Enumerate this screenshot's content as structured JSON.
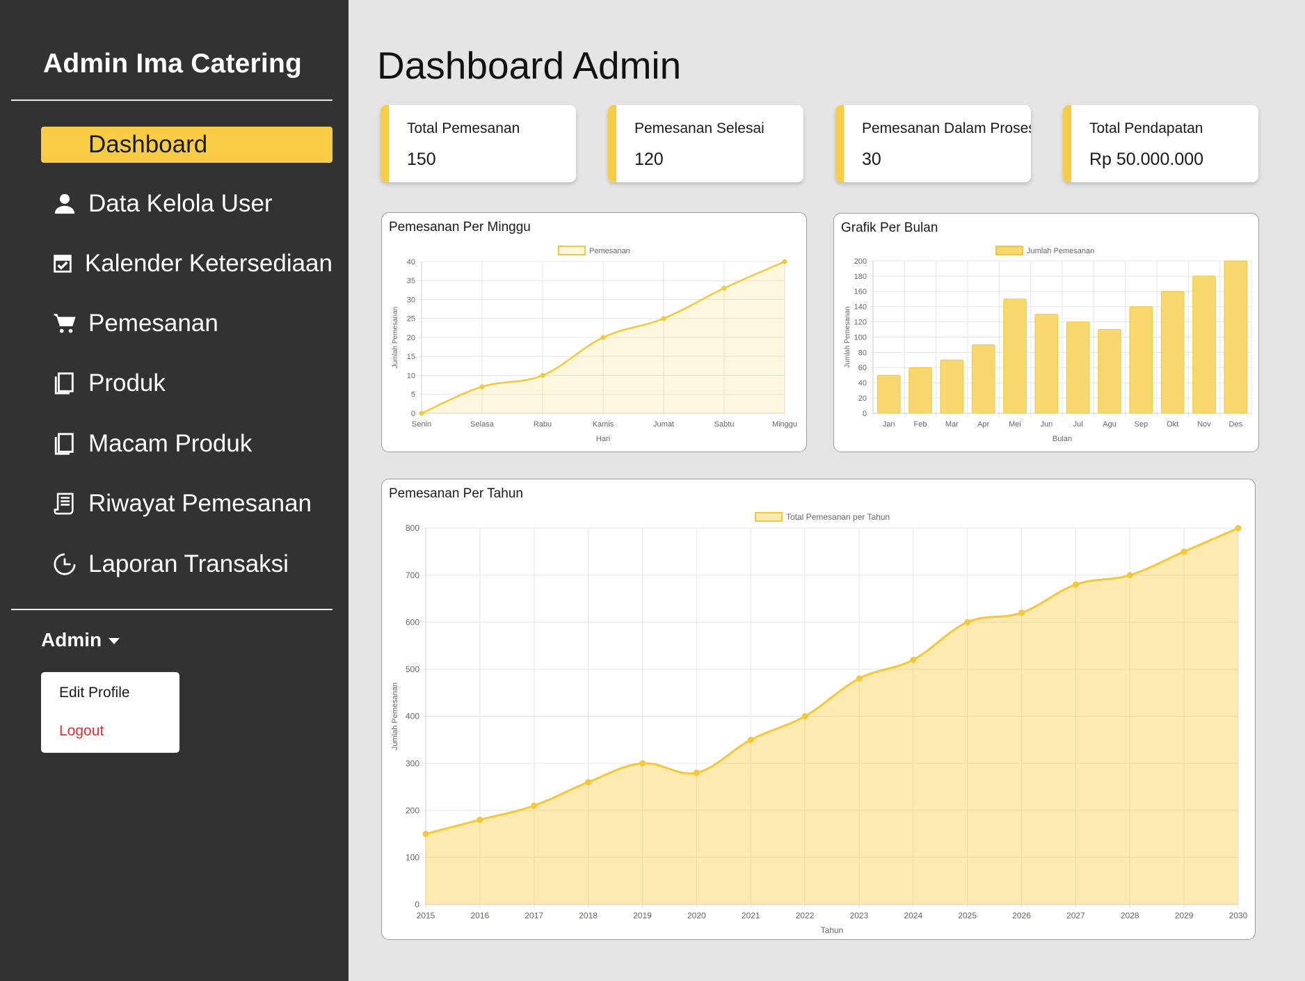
{
  "sidebar": {
    "brand": "Admin Ima Catering",
    "items": [
      {
        "label": "Dashboard",
        "icon": "dashboard-icon",
        "active": true
      },
      {
        "label": "Data Kelola User",
        "icon": "user-icon"
      },
      {
        "label": "Kalender Ketersediaan",
        "icon": "calendar-check-icon"
      },
      {
        "label": "Pemesanan",
        "icon": "cart-icon"
      },
      {
        "label": "Produk",
        "icon": "copy-icon"
      },
      {
        "label": "Macam Produk",
        "icon": "copy-icon"
      },
      {
        "label": "Riwayat Pemesanan",
        "icon": "receipt-icon"
      },
      {
        "label": "Laporan Transaksi",
        "icon": "clock-report-icon"
      }
    ],
    "admin_label": "Admin",
    "dropdown": {
      "edit_profile": "Edit Profile",
      "logout": "Logout"
    }
  },
  "main": {
    "title": "Dashboard Admin",
    "stats": [
      {
        "label": "Total Pemesanan",
        "value": "150"
      },
      {
        "label": "Pemesanan Selesai",
        "value": "120"
      },
      {
        "label": "Pemesanan Dalam Proses",
        "value": "30"
      },
      {
        "label": "Total Pendapatan",
        "value": "Rp 50.000.000"
      }
    ]
  },
  "colors": {
    "accent": "#f8cd45",
    "sidebar": "#323232",
    "logout": "#dd3333"
  },
  "chart_data": [
    {
      "type": "line",
      "title": "Pemesanan Per Minggu",
      "legend": "Pemesanan",
      "categories": [
        "Senin",
        "Selasa",
        "Rabu",
        "Kamis",
        "Jumat",
        "Sabtu",
        "Minggu"
      ],
      "values": [
        0,
        7,
        10,
        20,
        25,
        33,
        40
      ],
      "xlabel": "Hari",
      "ylabel": "Jumlah Pemesanan",
      "ylim": [
        0,
        40
      ],
      "yticks": [
        0,
        5,
        10,
        15,
        20,
        25,
        30,
        35,
        40
      ],
      "grid": true,
      "legend_position": "top"
    },
    {
      "type": "bar",
      "title": "Grafik Per Bulan",
      "legend": "Jumlah Pemesanan",
      "categories": [
        "Jan",
        "Feb",
        "Mar",
        "Apr",
        "Mei",
        "Jun",
        "Jul",
        "Agu",
        "Sep",
        "Okt",
        "Nov",
        "Des"
      ],
      "values": [
        50,
        60,
        70,
        90,
        150,
        130,
        120,
        110,
        140,
        160,
        180,
        200
      ],
      "xlabel": "Bulan",
      "ylabel": "Jumlah Pemesanan",
      "ylim": [
        0,
        200
      ],
      "yticks": [
        0,
        20,
        40,
        60,
        80,
        100,
        120,
        140,
        160,
        180,
        200
      ],
      "grid": true,
      "legend_position": "top"
    },
    {
      "type": "area",
      "title": "Pemesanan Per Tahun",
      "legend": "Total Pemesanan per Tahun",
      "categories": [
        "2015",
        "2016",
        "2017",
        "2018",
        "2019",
        "2020",
        "2021",
        "2022",
        "2023",
        "2024",
        "2025",
        "2026",
        "2027",
        "2028",
        "2029",
        "2030"
      ],
      "values": [
        150,
        180,
        210,
        260,
        300,
        280,
        350,
        400,
        480,
        520,
        600,
        620,
        680,
        700,
        750,
        800
      ],
      "xlabel": "Tahun",
      "ylabel": "Jumlah Pemesanan",
      "ylim": [
        0,
        800
      ],
      "yticks": [
        0,
        100,
        200,
        300,
        400,
        500,
        600,
        700,
        800
      ],
      "grid": true,
      "legend_position": "top"
    }
  ]
}
